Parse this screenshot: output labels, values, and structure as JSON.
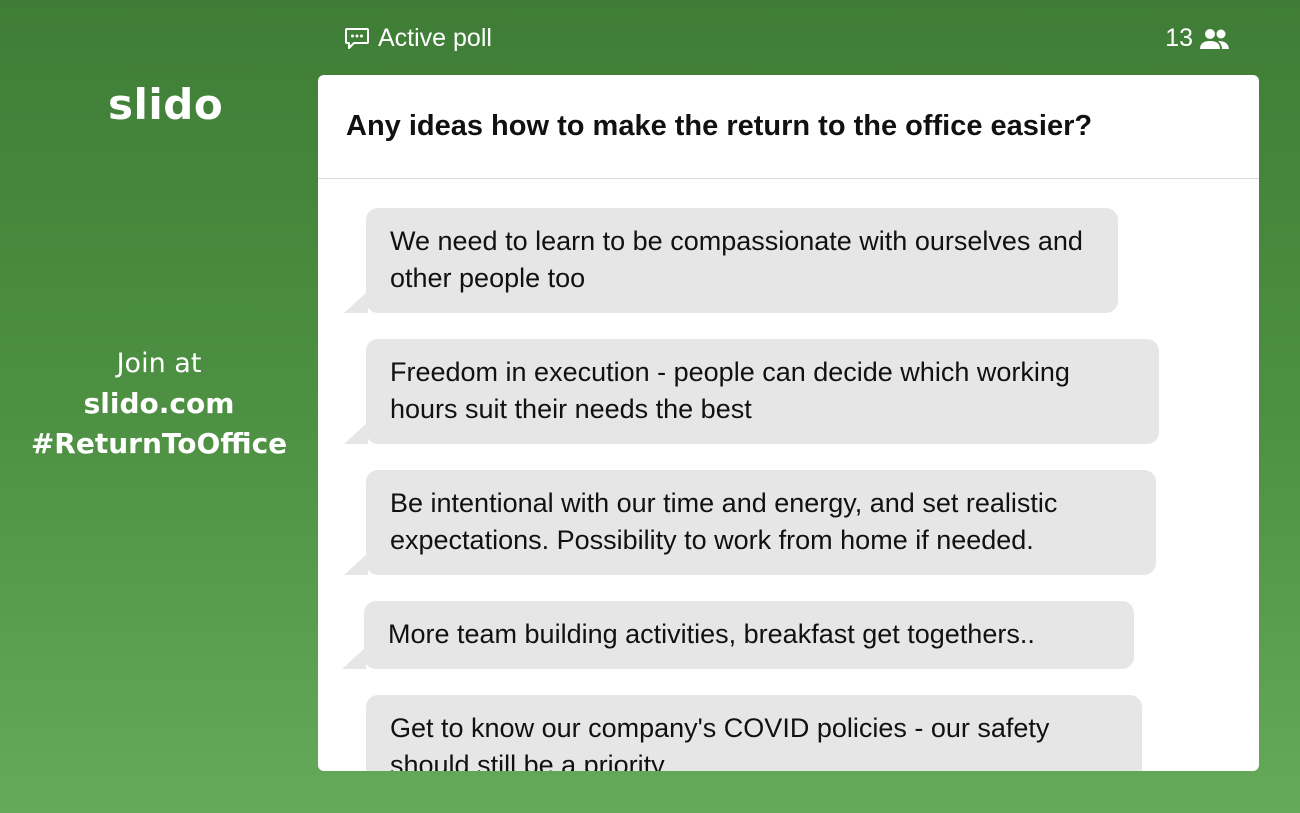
{
  "brand": {
    "logo": "slido",
    "join_line1": "Join at",
    "join_line2": "slido.com",
    "join_line3": "#ReturnToOffice"
  },
  "topbar": {
    "status": "Active poll",
    "status_icon": "chat-bubble-icon",
    "participant_count": "13",
    "participant_icon": "people-icon"
  },
  "poll": {
    "question": "Any ideas how to make the return to the office easier?",
    "answers": [
      "We need to learn to be compassionate with ourselves and other people too",
      "Freedom in execution - people can decide which working hours suit their needs the best",
      "Be intentional with our time and energy, and set realistic expectations. Possibility to work from home if needed.",
      "More team building activities, breakfast get togethers..",
      "Get to know our company's COVID policies - our safety should still be a priority"
    ]
  },
  "colors": {
    "background_top": "#3f7d36",
    "background_bottom": "#65a95b",
    "bubble": "#e6e6e6",
    "card": "#ffffff"
  }
}
